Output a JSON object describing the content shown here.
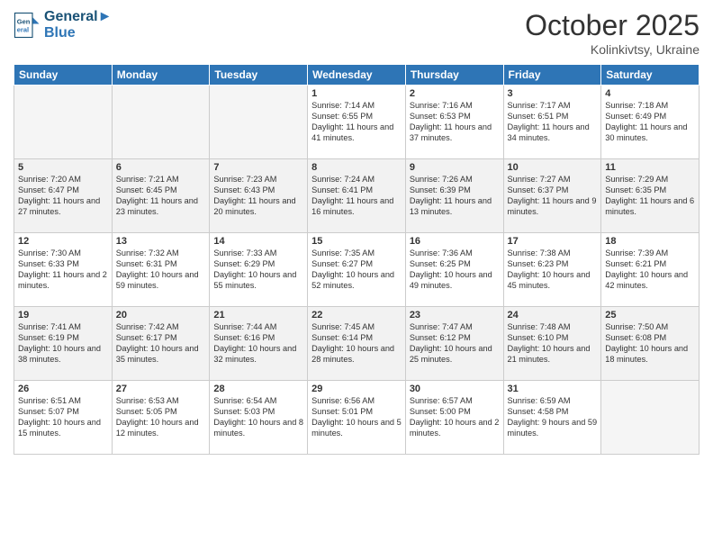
{
  "header": {
    "logo_line1": "General",
    "logo_line2": "Blue",
    "month": "October 2025",
    "location": "Kolinkivtsy, Ukraine"
  },
  "days_of_week": [
    "Sunday",
    "Monday",
    "Tuesday",
    "Wednesday",
    "Thursday",
    "Friday",
    "Saturday"
  ],
  "weeks": [
    [
      {
        "day": "",
        "sunrise": "",
        "sunset": "",
        "daylight": "",
        "empty": true
      },
      {
        "day": "",
        "sunrise": "",
        "sunset": "",
        "daylight": "",
        "empty": true
      },
      {
        "day": "",
        "sunrise": "",
        "sunset": "",
        "daylight": "",
        "empty": true
      },
      {
        "day": "1",
        "sunrise": "Sunrise: 7:14 AM",
        "sunset": "Sunset: 6:55 PM",
        "daylight": "Daylight: 11 hours and 41 minutes."
      },
      {
        "day": "2",
        "sunrise": "Sunrise: 7:16 AM",
        "sunset": "Sunset: 6:53 PM",
        "daylight": "Daylight: 11 hours and 37 minutes."
      },
      {
        "day": "3",
        "sunrise": "Sunrise: 7:17 AM",
        "sunset": "Sunset: 6:51 PM",
        "daylight": "Daylight: 11 hours and 34 minutes."
      },
      {
        "day": "4",
        "sunrise": "Sunrise: 7:18 AM",
        "sunset": "Sunset: 6:49 PM",
        "daylight": "Daylight: 11 hours and 30 minutes."
      }
    ],
    [
      {
        "day": "5",
        "sunrise": "Sunrise: 7:20 AM",
        "sunset": "Sunset: 6:47 PM",
        "daylight": "Daylight: 11 hours and 27 minutes."
      },
      {
        "day": "6",
        "sunrise": "Sunrise: 7:21 AM",
        "sunset": "Sunset: 6:45 PM",
        "daylight": "Daylight: 11 hours and 23 minutes."
      },
      {
        "day": "7",
        "sunrise": "Sunrise: 7:23 AM",
        "sunset": "Sunset: 6:43 PM",
        "daylight": "Daylight: 11 hours and 20 minutes."
      },
      {
        "day": "8",
        "sunrise": "Sunrise: 7:24 AM",
        "sunset": "Sunset: 6:41 PM",
        "daylight": "Daylight: 11 hours and 16 minutes."
      },
      {
        "day": "9",
        "sunrise": "Sunrise: 7:26 AM",
        "sunset": "Sunset: 6:39 PM",
        "daylight": "Daylight: 11 hours and 13 minutes."
      },
      {
        "day": "10",
        "sunrise": "Sunrise: 7:27 AM",
        "sunset": "Sunset: 6:37 PM",
        "daylight": "Daylight: 11 hours and 9 minutes."
      },
      {
        "day": "11",
        "sunrise": "Sunrise: 7:29 AM",
        "sunset": "Sunset: 6:35 PM",
        "daylight": "Daylight: 11 hours and 6 minutes."
      }
    ],
    [
      {
        "day": "12",
        "sunrise": "Sunrise: 7:30 AM",
        "sunset": "Sunset: 6:33 PM",
        "daylight": "Daylight: 11 hours and 2 minutes."
      },
      {
        "day": "13",
        "sunrise": "Sunrise: 7:32 AM",
        "sunset": "Sunset: 6:31 PM",
        "daylight": "Daylight: 10 hours and 59 minutes."
      },
      {
        "day": "14",
        "sunrise": "Sunrise: 7:33 AM",
        "sunset": "Sunset: 6:29 PM",
        "daylight": "Daylight: 10 hours and 55 minutes."
      },
      {
        "day": "15",
        "sunrise": "Sunrise: 7:35 AM",
        "sunset": "Sunset: 6:27 PM",
        "daylight": "Daylight: 10 hours and 52 minutes."
      },
      {
        "day": "16",
        "sunrise": "Sunrise: 7:36 AM",
        "sunset": "Sunset: 6:25 PM",
        "daylight": "Daylight: 10 hours and 49 minutes."
      },
      {
        "day": "17",
        "sunrise": "Sunrise: 7:38 AM",
        "sunset": "Sunset: 6:23 PM",
        "daylight": "Daylight: 10 hours and 45 minutes."
      },
      {
        "day": "18",
        "sunrise": "Sunrise: 7:39 AM",
        "sunset": "Sunset: 6:21 PM",
        "daylight": "Daylight: 10 hours and 42 minutes."
      }
    ],
    [
      {
        "day": "19",
        "sunrise": "Sunrise: 7:41 AM",
        "sunset": "Sunset: 6:19 PM",
        "daylight": "Daylight: 10 hours and 38 minutes."
      },
      {
        "day": "20",
        "sunrise": "Sunrise: 7:42 AM",
        "sunset": "Sunset: 6:17 PM",
        "daylight": "Daylight: 10 hours and 35 minutes."
      },
      {
        "day": "21",
        "sunrise": "Sunrise: 7:44 AM",
        "sunset": "Sunset: 6:16 PM",
        "daylight": "Daylight: 10 hours and 32 minutes."
      },
      {
        "day": "22",
        "sunrise": "Sunrise: 7:45 AM",
        "sunset": "Sunset: 6:14 PM",
        "daylight": "Daylight: 10 hours and 28 minutes."
      },
      {
        "day": "23",
        "sunrise": "Sunrise: 7:47 AM",
        "sunset": "Sunset: 6:12 PM",
        "daylight": "Daylight: 10 hours and 25 minutes."
      },
      {
        "day": "24",
        "sunrise": "Sunrise: 7:48 AM",
        "sunset": "Sunset: 6:10 PM",
        "daylight": "Daylight: 10 hours and 21 minutes."
      },
      {
        "day": "25",
        "sunrise": "Sunrise: 7:50 AM",
        "sunset": "Sunset: 6:08 PM",
        "daylight": "Daylight: 10 hours and 18 minutes."
      }
    ],
    [
      {
        "day": "26",
        "sunrise": "Sunrise: 6:51 AM",
        "sunset": "Sunset: 5:07 PM",
        "daylight": "Daylight: 10 hours and 15 minutes."
      },
      {
        "day": "27",
        "sunrise": "Sunrise: 6:53 AM",
        "sunset": "Sunset: 5:05 PM",
        "daylight": "Daylight: 10 hours and 12 minutes."
      },
      {
        "day": "28",
        "sunrise": "Sunrise: 6:54 AM",
        "sunset": "Sunset: 5:03 PM",
        "daylight": "Daylight: 10 hours and 8 minutes."
      },
      {
        "day": "29",
        "sunrise": "Sunrise: 6:56 AM",
        "sunset": "Sunset: 5:01 PM",
        "daylight": "Daylight: 10 hours and 5 minutes."
      },
      {
        "day": "30",
        "sunrise": "Sunrise: 6:57 AM",
        "sunset": "Sunset: 5:00 PM",
        "daylight": "Daylight: 10 hours and 2 minutes."
      },
      {
        "day": "31",
        "sunrise": "Sunrise: 6:59 AM",
        "sunset": "Sunset: 4:58 PM",
        "daylight": "Daylight: 9 hours and 59 minutes."
      },
      {
        "day": "",
        "sunrise": "",
        "sunset": "",
        "daylight": "",
        "empty": true
      }
    ]
  ]
}
